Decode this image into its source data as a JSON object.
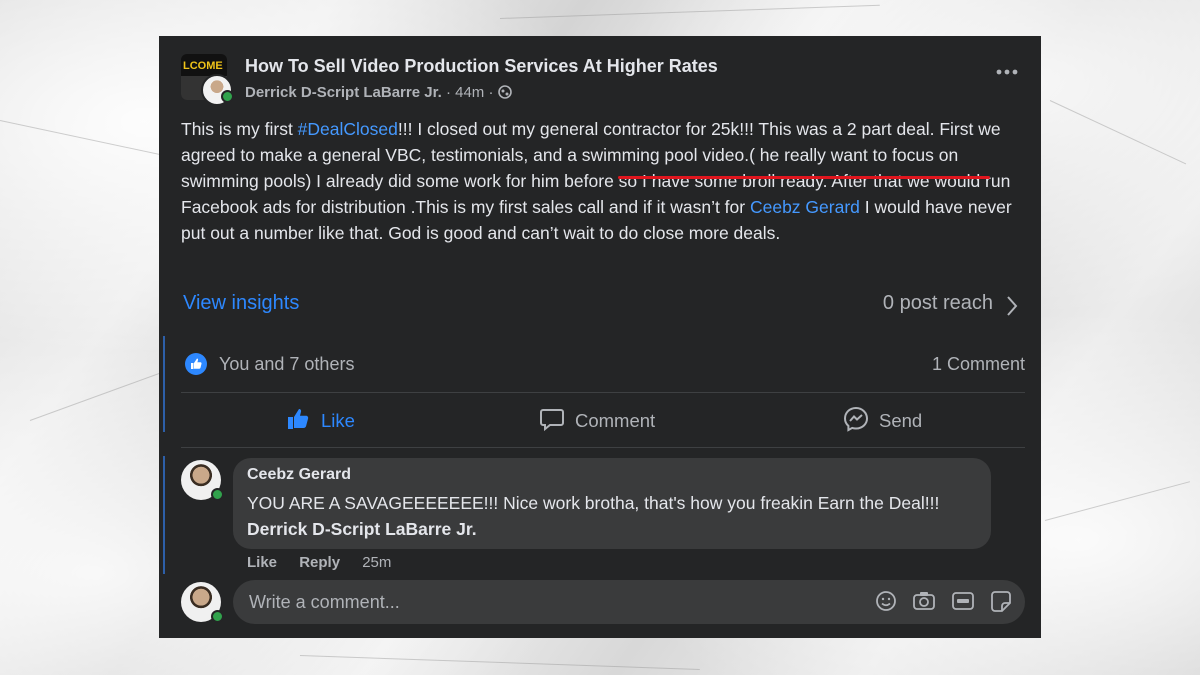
{
  "post": {
    "group_title": "How To Sell Video Production Services At Higher Rates",
    "group_logo_text": "LCOME",
    "author": "Derrick D-Script LaBarre Jr.",
    "time": "44m",
    "privacy_icon": "globe-icon",
    "more_icon": "more-icon",
    "text_start": "This is my first ",
    "hashtag": "#DealClosed",
    "text_mid1": "!!! I closed out my general contractor for 25k!!! This was a 2 part deal. First we agreed to make a general VBC, testimonials, and a swimming pool video.( he really want to focus on swimming pools) I already did some work for him before so I have some broll ready. After that we would run Facebook ads for distribution  .This is my first sales call and if it wasn’t for ",
    "mention": "Ceebz Gerard",
    "text_end": " I would have never put out a number like that. God is good and can’t wait to do close more deals."
  },
  "insights": {
    "view_label": "View insights",
    "reach_label": "0 post reach"
  },
  "reactions": {
    "summary": "You and 7 others",
    "comments": "1 Comment"
  },
  "actions": {
    "like": "Like",
    "comment": "Comment",
    "send": "Send"
  },
  "comment": {
    "author": "Ceebz Gerard",
    "text": "YOU ARE A SAVAGEEEEEEE!!! Nice work brotha, that's how you freakin Earn the Deal!!! ",
    "mention": "Derrick D-Script LaBarre Jr.",
    "like": "Like",
    "reply": "Reply",
    "time": "25m"
  },
  "composer": {
    "placeholder": "Write a comment..."
  },
  "colors": {
    "card_bg": "#242526",
    "link": "#2d88ff",
    "highlight_underline": "#e0161e",
    "online": "#31a24c"
  }
}
